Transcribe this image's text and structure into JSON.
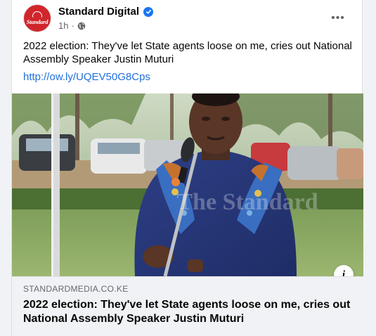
{
  "post": {
    "page_name": "Standard Digital",
    "avatar_brand": "Standard",
    "timestamp": "1h",
    "separator": "·",
    "audience_icon": "globe-icon",
    "verified_icon": "verified-badge-icon",
    "more_icon": "more-options-icon",
    "more_glyph": "•••",
    "text": "2022 election: They've let State agents loose on me, cries out National Assembly Speaker Justin Muturi",
    "link_text": "http://ow.ly/UQEV50G8Cps"
  },
  "photo": {
    "watermark": "The Standard"
  },
  "preview": {
    "info_glyph": "i",
    "domain": "STANDARDMEDIA.CO.KE",
    "headline": "2022 election: They've let State agents loose on me, cries out National Assembly Speaker Justin Muturi"
  },
  "colors": {
    "brand_red": "#d0262b",
    "verified_blue": "#1877f2",
    "link_blue": "#216fdb",
    "secondary_text": "#65676b"
  }
}
